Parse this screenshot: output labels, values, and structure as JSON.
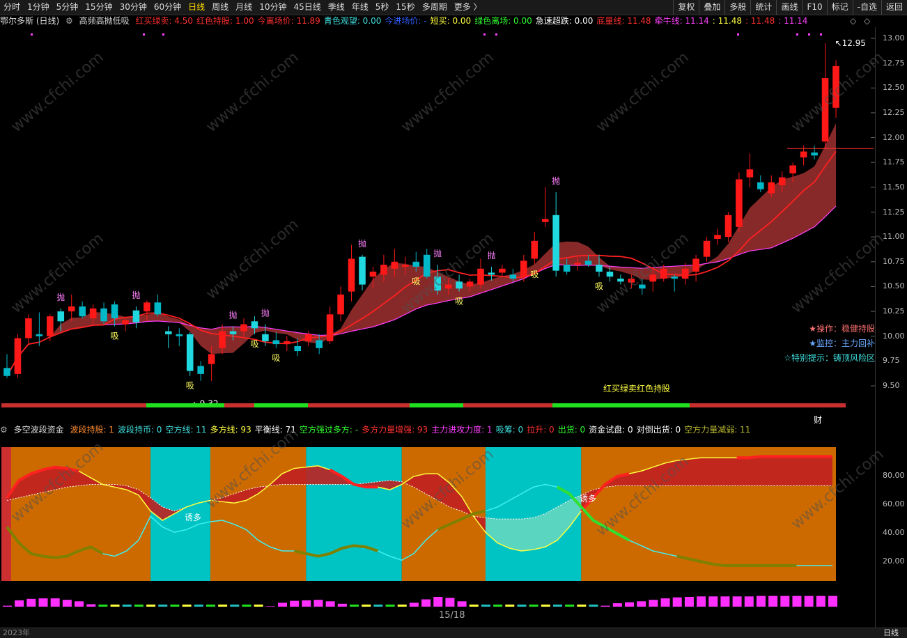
{
  "toolbar": {
    "periods": [
      "分时",
      "1分钟",
      "5分钟",
      "15分钟",
      "30分钟",
      "60分钟",
      "日线",
      "周线",
      "月线",
      "10分钟",
      "45日线",
      "季线",
      "年线",
      "5秒",
      "15秒",
      "多周期",
      "更多 〉"
    ],
    "active_period": "日线",
    "tools": [
      "复权",
      "叠加",
      "多股",
      "统计",
      "画线",
      "F10",
      "标记",
      "-自选",
      "返回"
    ]
  },
  "main_info": {
    "stock_name": "鄂尔多斯 (日线)",
    "indicator": "高频高抛低吸",
    "items": [
      {
        "label": "红买绿卖: 4.50",
        "color": "#ff3030"
      },
      {
        "label": "红色持股: 1.00",
        "color": "#ff3030"
      },
      {
        "label": "今离场价: 11.89",
        "color": "#ff3030"
      },
      {
        "label": "青色观望: 0.00",
        "color": "#40e0e0"
      },
      {
        "label": "今进场价: -",
        "color": "#3060ff"
      },
      {
        "label": "短买: 0.00",
        "color": "#ffff40"
      },
      {
        "label": "绿色离场: 0.00",
        "color": "#30ff30"
      },
      {
        "label": "急速超跌: 0.00",
        "color": "#ffffff"
      },
      {
        "label": "底量线: 11.48",
        "color": "#ff3030"
      },
      {
        "label": "牵牛线: 11.14",
        "color": "#ff40ff"
      },
      {
        "label": ": 11.48",
        "color": "#ffff40"
      },
      {
        "label": ": 11.48",
        "color": "#ff3030"
      },
      {
        "label": ": 11.14",
        "color": "#ff40ff"
      }
    ]
  },
  "sub_info": {
    "indicator": "多空波段资金",
    "items": [
      {
        "label": "波段持股: 1",
        "color": "#ff8c30"
      },
      {
        "label": "波段持币: 0",
        "color": "#40e0e0"
      },
      {
        "label": "空方线: 11",
        "color": "#40e0e0"
      },
      {
        "label": "多方线: 93",
        "color": "#ffff40"
      },
      {
        "label": "平衡线: 71",
        "color": "#ffffff"
      },
      {
        "label": "空方强过多方: -",
        "color": "#30ff30"
      },
      {
        "label": "多方力量增强: 93",
        "color": "#ff3030"
      },
      {
        "label": "主力进攻力度: 1",
        "color": "#ff40ff"
      },
      {
        "label": "吸筹: 0",
        "color": "#40e0e0"
      },
      {
        "label": "拉升: 0",
        "color": "#ff3030"
      },
      {
        "label": "出货: 0",
        "color": "#30ff30"
      },
      {
        "label": "资金试盘: 0",
        "color": "#ffffff"
      },
      {
        "label": "对倒出货: 0",
        "color": "#ffffff"
      },
      {
        "label": "空方力量减弱: 11",
        "color": "#b8b830"
      }
    ]
  },
  "notes": {
    "op": "★操作：稳健持股",
    "monitor": "★监控：主力回补",
    "special": "☆特别提示：铸顶风险区",
    "legend": "红买绿卖红色持股",
    "cai": "财",
    "page": "15/18",
    "year": "2023年",
    "period_label": "日线",
    "watermark": "www.cfchi.com"
  },
  "chart_data": {
    "type": "candlestick",
    "price_axis": {
      "min": 9.5,
      "max": 13.0,
      "ticks": [
        "13.00",
        "12.75",
        "12.50",
        "12.25",
        "12.00",
        "11.75",
        "11.50",
        "11.25",
        "11.00",
        "10.75",
        "10.50",
        "10.25",
        "10.00",
        "9.75",
        "9.50"
      ]
    },
    "annotations": {
      "high": "12.95",
      "low": "9.32"
    },
    "candles": [
      [
        9.68,
        9.82,
        9.58,
        9.6
      ],
      [
        9.62,
        10.02,
        9.58,
        9.98
      ],
      [
        9.98,
        10.22,
        9.92,
        10.18
      ],
      [
        10.02,
        10.24,
        9.9,
        10.0
      ],
      [
        10.0,
        10.22,
        9.95,
        10.2
      ],
      [
        10.15,
        10.28,
        10.05,
        10.25
      ],
      [
        10.25,
        10.42,
        10.15,
        10.3
      ],
      [
        10.3,
        10.35,
        10.18,
        10.2
      ],
      [
        10.18,
        10.32,
        10.12,
        10.28
      ],
      [
        10.28,
        10.34,
        10.12,
        10.15
      ],
      [
        10.32,
        10.35,
        10.1,
        10.18
      ],
      [
        10.12,
        10.18,
        10.05,
        10.16
      ],
      [
        10.14,
        10.3,
        10.08,
        10.26
      ],
      [
        10.25,
        10.36,
        10.15,
        10.34
      ],
      [
        10.34,
        10.42,
        10.2,
        10.22
      ],
      [
        10.05,
        10.1,
        9.88,
        10.02
      ],
      [
        10.02,
        10.08,
        9.9,
        10.0
      ],
      [
        10.02,
        10.04,
        9.6,
        9.65
      ],
      [
        9.7,
        9.75,
        9.55,
        9.62
      ],
      [
        9.72,
        9.9,
        9.55,
        9.82
      ],
      [
        9.88,
        10.12,
        9.82,
        10.05
      ],
      [
        10.05,
        10.1,
        9.96,
        10.02
      ],
      [
        10.05,
        10.18,
        10.0,
        10.12
      ],
      [
        10.08,
        10.2,
        10.02,
        10.15
      ],
      [
        10.02,
        10.12,
        9.9,
        9.95
      ],
      [
        9.96,
        10.04,
        9.88,
        9.92
      ],
      [
        9.92,
        10.0,
        9.85,
        9.95
      ],
      [
        9.9,
        9.98,
        9.8,
        9.85
      ],
      [
        9.95,
        10.05,
        9.9,
        10.02
      ],
      [
        9.96,
        10.02,
        9.82,
        9.88
      ],
      [
        9.95,
        10.3,
        9.92,
        10.22
      ],
      [
        10.22,
        10.5,
        10.15,
        10.42
      ],
      [
        10.45,
        10.92,
        10.35,
        10.78
      ],
      [
        10.52,
        10.82,
        10.46,
        10.8
      ],
      [
        10.6,
        10.7,
        10.48,
        10.65
      ],
      [
        10.62,
        10.82,
        10.55,
        10.72
      ],
      [
        10.68,
        10.88,
        10.6,
        10.75
      ],
      [
        10.7,
        10.8,
        10.62,
        10.72
      ],
      [
        10.75,
        10.85,
        10.65,
        10.7
      ],
      [
        10.82,
        10.88,
        10.58,
        10.6
      ],
      [
        10.6,
        10.72,
        10.42,
        10.46
      ],
      [
        10.48,
        10.58,
        10.42,
        10.52
      ],
      [
        10.55,
        10.62,
        10.45,
        10.48
      ],
      [
        10.5,
        10.58,
        10.45,
        10.55
      ],
      [
        10.52,
        10.78,
        10.48,
        10.68
      ],
      [
        10.62,
        10.7,
        10.56,
        10.64
      ],
      [
        10.64,
        10.72,
        10.6,
        10.68
      ],
      [
        10.62,
        10.68,
        10.55,
        10.58
      ],
      [
        10.6,
        10.82,
        10.55,
        10.76
      ],
      [
        10.78,
        11.05,
        10.72,
        10.96
      ],
      [
        11.15,
        11.5,
        11.1,
        11.18
      ],
      [
        10.66,
        11.45,
        10.6,
        11.22
      ],
      [
        10.72,
        10.78,
        10.62,
        10.65
      ],
      [
        10.72,
        10.8,
        10.66,
        10.74
      ],
      [
        10.76,
        10.82,
        10.7,
        10.72
      ],
      [
        10.72,
        10.82,
        10.6,
        10.65
      ],
      [
        10.65,
        10.7,
        10.55,
        10.6
      ],
      [
        10.58,
        10.62,
        10.52,
        10.55
      ],
      [
        10.54,
        10.62,
        10.48,
        10.58
      ],
      [
        10.52,
        10.58,
        10.42,
        10.48
      ],
      [
        10.55,
        10.68,
        10.45,
        10.62
      ],
      [
        10.58,
        10.72,
        10.55,
        10.68
      ],
      [
        10.6,
        10.62,
        10.45,
        10.58
      ],
      [
        10.58,
        10.74,
        10.52,
        10.68
      ],
      [
        10.65,
        10.82,
        10.55,
        10.78
      ],
      [
        10.8,
        11.0,
        10.75,
        10.96
      ],
      [
        10.98,
        11.08,
        10.92,
        11.02
      ],
      [
        11.0,
        11.25,
        10.95,
        11.22
      ],
      [
        11.1,
        11.65,
        11.05,
        11.58
      ],
      [
        11.6,
        11.84,
        11.5,
        11.68
      ],
      [
        11.55,
        11.62,
        11.45,
        11.48
      ],
      [
        11.44,
        11.62,
        11.4,
        11.55
      ],
      [
        11.52,
        11.66,
        11.45,
        11.6
      ],
      [
        11.64,
        11.75,
        11.55,
        11.72
      ],
      [
        11.8,
        11.92,
        11.72,
        11.86
      ],
      [
        11.85,
        11.92,
        11.78,
        11.82
      ],
      [
        11.96,
        12.95,
        11.9,
        12.6
      ],
      [
        12.3,
        12.78,
        12.2,
        12.72
      ]
    ],
    "signals": [
      {
        "i": 5,
        "text": "抛"
      },
      {
        "i": 10,
        "text": "吸"
      },
      {
        "i": 12,
        "text": "抛"
      },
      {
        "i": 17,
        "text": "吸"
      },
      {
        "i": 21,
        "text": "抛"
      },
      {
        "i": 23,
        "text": "吸"
      },
      {
        "i": 24,
        "text": "抛"
      },
      {
        "i": 25,
        "text": "吸"
      },
      {
        "i": 33,
        "text": "抛"
      },
      {
        "i": 38,
        "text": "吸"
      },
      {
        "i": 40,
        "text": "抛"
      },
      {
        "i": 42,
        "text": "吸"
      },
      {
        "i": 45,
        "text": "抛"
      },
      {
        "i": 49,
        "text": "吸"
      },
      {
        "i": 51,
        "text": "抛"
      },
      {
        "i": 55,
        "text": "吸"
      }
    ],
    "sub_axis": {
      "min": 0,
      "max": 100,
      "ticks": [
        "80.00",
        "60.00",
        "40.00",
        "20.00"
      ]
    },
    "sub_labels": [
      "诱多",
      "诱多"
    ],
    "zones": [
      "long",
      "short",
      "long",
      "short",
      "long",
      "short",
      "long"
    ],
    "zone_bounds": [
      0,
      12,
      17,
      25,
      33,
      40,
      48,
      58,
      70
    ],
    "lines": {
      "bull": [
        62,
        75,
        80,
        83,
        85,
        84,
        82,
        77,
        72,
        70,
        68,
        64,
        52,
        45,
        50,
        55,
        58,
        60,
        59,
        58,
        60,
        65,
        72,
        80,
        84,
        85,
        86,
        83,
        78,
        72,
        70,
        70,
        68,
        72,
        78,
        80,
        80,
        73,
        63,
        48,
        36,
        28,
        24,
        22,
        23,
        25,
        30,
        40,
        52,
        62,
        72,
        78,
        80,
        82,
        85,
        88,
        90,
        91,
        92,
        92,
        92,
        92,
        92,
        93,
        93,
        93,
        93,
        93,
        93,
        93
      ],
      "balance": [
        60,
        62,
        64,
        66,
        68,
        70,
        71,
        72,
        72,
        72,
        71,
        68,
        62,
        55,
        52,
        55,
        58,
        60,
        62,
        65,
        68,
        70,
        71,
        72,
        72,
        72,
        72,
        72,
        72,
        72,
        73,
        74,
        75,
        74,
        70,
        65,
        60,
        55,
        52,
        48,
        47,
        46,
        46,
        46,
        47,
        50,
        55,
        60,
        64,
        68,
        70,
        71,
        71,
        71,
        71,
        71,
        71,
        71,
        71,
        71,
        71,
        71,
        71,
        71,
        71,
        71,
        71,
        71,
        71,
        71
      ],
      "bear": [
        40,
        28,
        20,
        18,
        17,
        18,
        22,
        25,
        20,
        18,
        22,
        30,
        48,
        40,
        36,
        38,
        42,
        44,
        45,
        42,
        38,
        30,
        25,
        22,
        22,
        20,
        18,
        20,
        24,
        26,
        25,
        22,
        18,
        15,
        20,
        30,
        38,
        42,
        46,
        50,
        52,
        55,
        60,
        65,
        70,
        72,
        70,
        65,
        55,
        45,
        40,
        35,
        30,
        26,
        22,
        20,
        18,
        16,
        14,
        12,
        11,
        11,
        11,
        11,
        11,
        11,
        11,
        11,
        11,
        11
      ]
    }
  }
}
